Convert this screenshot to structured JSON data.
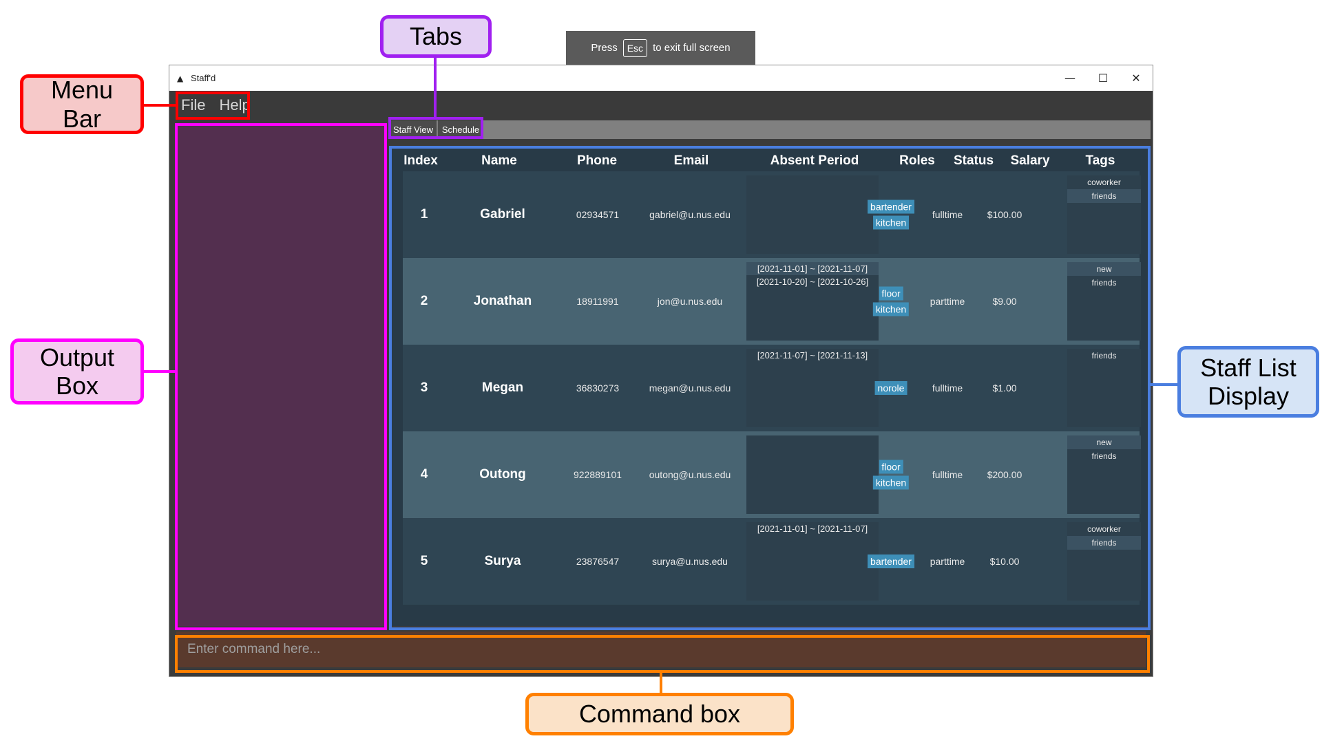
{
  "fullscreen_hint": {
    "before": "Press",
    "key": "Esc",
    "after": "to exit full screen"
  },
  "window": {
    "title": "Staff'd",
    "app_icon": "app-icon",
    "controls": {
      "minimize": "—",
      "maximize": "☐",
      "close": "✕"
    }
  },
  "menu": {
    "file": "File",
    "help": "Help"
  },
  "tabs": {
    "staff_view": "Staff View",
    "schedule": "Schedule"
  },
  "table": {
    "headers": {
      "index": "Index",
      "name": "Name",
      "phone": "Phone",
      "email": "Email",
      "absent_period": "Absent Period",
      "roles": "Roles",
      "status": "Status",
      "salary": "Salary",
      "tags": "Tags"
    },
    "rows": [
      {
        "index": "1",
        "name": "Gabriel",
        "phone": "02934571",
        "email": "gabriel@u.nus.edu",
        "absent": [],
        "roles": [
          "bartender",
          "kitchen"
        ],
        "status": "fulltime",
        "salary": "$100.00",
        "tags": [
          "coworker",
          "friends"
        ]
      },
      {
        "index": "2",
        "name": "Jonathan",
        "phone": "18911991",
        "email": "jon@u.nus.edu",
        "absent": [
          "[2021-11-01] ~ [2021-11-07]",
          "[2021-10-20] ~ [2021-10-26]"
        ],
        "roles": [
          "floor",
          "kitchen"
        ],
        "status": "parttime",
        "salary": "$9.00",
        "tags": [
          "new",
          "friends"
        ]
      },
      {
        "index": "3",
        "name": "Megan",
        "phone": "36830273",
        "email": "megan@u.nus.edu",
        "absent": [
          "[2021-11-07] ~ [2021-11-13]"
        ],
        "roles": [
          "norole"
        ],
        "status": "fulltime",
        "salary": "$1.00",
        "tags": [
          "friends"
        ]
      },
      {
        "index": "4",
        "name": "Outong",
        "phone": "922889101",
        "email": "outong@u.nus.edu",
        "absent": [],
        "roles": [
          "floor",
          "kitchen"
        ],
        "status": "fulltime",
        "salary": "$200.00",
        "tags": [
          "new",
          "friends"
        ]
      },
      {
        "index": "5",
        "name": "Surya",
        "phone": "23876547",
        "email": "surya@u.nus.edu",
        "absent": [
          "[2021-11-01] ~ [2021-11-07]"
        ],
        "roles": [
          "bartender"
        ],
        "status": "parttime",
        "salary": "$10.00",
        "tags": [
          "coworker",
          "friends"
        ]
      }
    ]
  },
  "command": {
    "placeholder": "Enter command here..."
  },
  "annotations": {
    "tabs": "Tabs",
    "menu_bar": "Menu\nBar",
    "output_box": "Output\nBox",
    "staff_list_display": "Staff List\nDisplay",
    "command_box": "Command box"
  },
  "colors": {
    "menu_bar_annotation": "#ff0000",
    "tabs_annotation": "#a020f0",
    "output_box_annotation": "#ff00ff",
    "staff_list_annotation": "#4a7ee0",
    "command_box_annotation": "#ff8000"
  }
}
